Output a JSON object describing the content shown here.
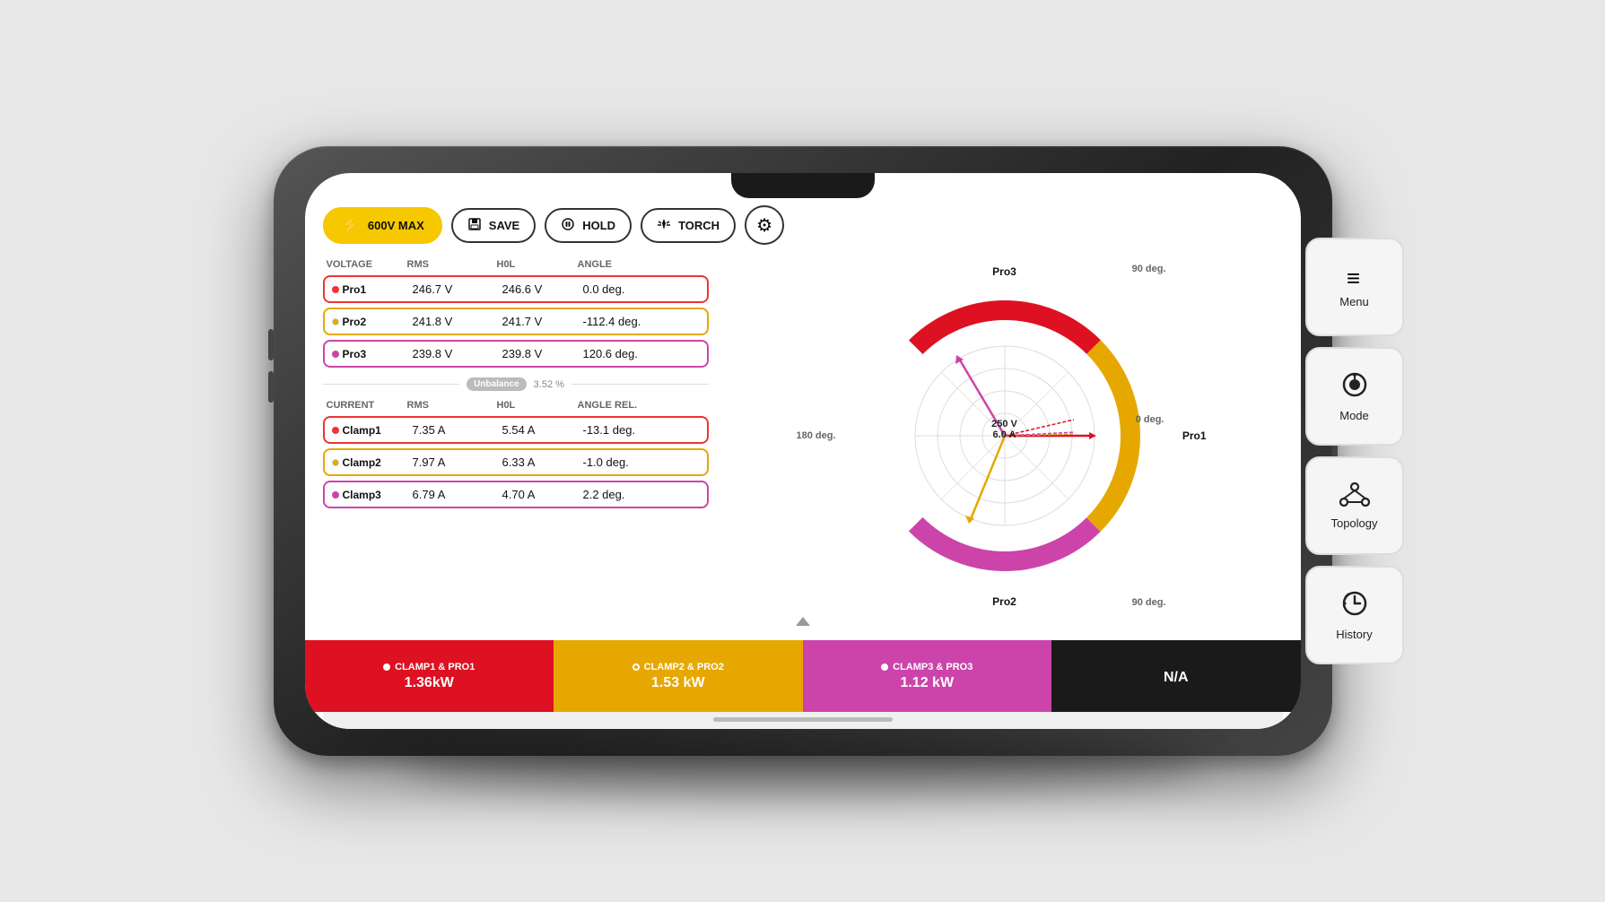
{
  "toolbar": {
    "voltage_warning": "600V MAX",
    "save_label": "SAVE",
    "hold_label": "HOLD",
    "torch_label": "TORCH",
    "gear_icon": "⚙"
  },
  "voltage_table": {
    "headers": [
      "VOLTAGE",
      "RMS",
      "h01",
      "Angle"
    ],
    "rows": [
      {
        "label": "Pro1",
        "dot": "red",
        "rms": "246.7 V",
        "h01": "246.6 V",
        "angle": "0.0 deg.",
        "class": "pro1"
      },
      {
        "label": "Pro2",
        "dot": "yellow",
        "rms": "241.8 V",
        "h01": "241.7 V",
        "angle": "-112.4 deg.",
        "class": "pro2"
      },
      {
        "label": "Pro3",
        "dot": "pink",
        "rms": "239.8 V",
        "h01": "239.8 V",
        "angle": "120.6 deg.",
        "class": "pro3"
      }
    ],
    "unbalance_label": "Unbalance",
    "unbalance_value": "3.52 %"
  },
  "current_table": {
    "headers": [
      "CURRENT",
      "RMS",
      "h01",
      "Angle Rel."
    ],
    "rows": [
      {
        "label": "Clamp1",
        "dot": "red",
        "rms": "7.35 A",
        "h01": "5.54 A",
        "angle": "-13.1 deg.",
        "class": "clamp1"
      },
      {
        "label": "Clamp2",
        "dot": "yellow",
        "rms": "7.97 A",
        "h01": "6.33 A",
        "angle": "-1.0 deg.",
        "class": "clamp2"
      },
      {
        "label": "Clamp3",
        "dot": "pink",
        "rms": "6.79 A",
        "h01": "4.70 A",
        "angle": "2.2 deg.",
        "class": "clamp3"
      }
    ]
  },
  "phasor": {
    "center_voltage": "250 V",
    "center_current": "6.0 A",
    "labels": {
      "top": "90 deg.",
      "right_phase": "Pro1",
      "right_deg": "0 deg.",
      "bottom_phase": "Pro2",
      "bottom_deg": "90 deg.",
      "left_deg": "180 deg.",
      "top_phase": "Pro3"
    }
  },
  "power_bar": {
    "cells": [
      {
        "label": "CLAMP1 & PRO1",
        "value": "1.36kW",
        "color": "red",
        "dot": "filled"
      },
      {
        "label": "CLAMP2 & PRO2",
        "value": "1.53 kW",
        "color": "yellow",
        "dot": "outline"
      },
      {
        "label": "CLAMP3 & PRO3",
        "value": "1.12 kW",
        "color": "pink",
        "dot": "filled"
      },
      {
        "label": "N/A",
        "value": "",
        "color": "dark",
        "dot": "none"
      }
    ]
  },
  "right_panel": {
    "buttons": [
      {
        "label": "Menu",
        "icon": "≡",
        "name": "menu-button"
      },
      {
        "label": "Mode",
        "icon": "◎",
        "name": "mode-button"
      },
      {
        "label": "Topology",
        "icon": "⋈",
        "name": "topology-button"
      },
      {
        "label": "History",
        "icon": "⟳",
        "name": "history-button"
      }
    ]
  }
}
